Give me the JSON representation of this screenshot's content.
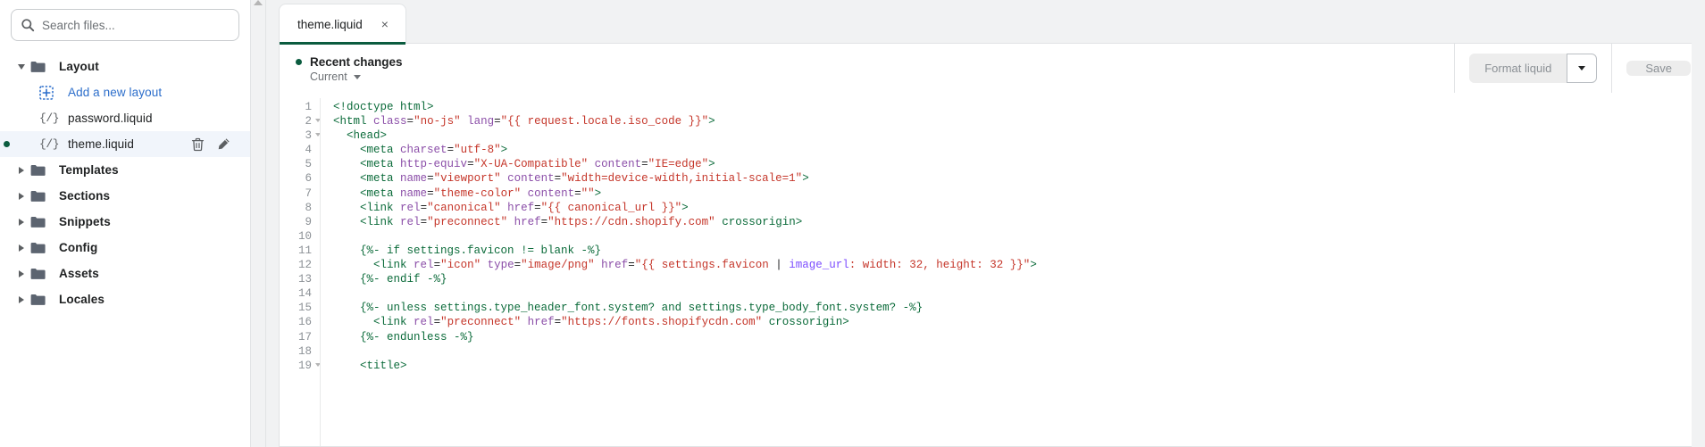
{
  "sidebar": {
    "search": {
      "placeholder": "Search files...",
      "value": "",
      "icon": "search-icon"
    },
    "tree": [
      {
        "label": "Layout",
        "type": "folder",
        "level": 0,
        "expanded": true,
        "icon": "folder-icon"
      },
      {
        "label": "Add a new layout",
        "type": "action",
        "level": 1,
        "icon": "add-box-icon"
      },
      {
        "label": "password.liquid",
        "type": "file",
        "level": 1,
        "icon": "liquid-file-icon"
      },
      {
        "label": "theme.liquid",
        "type": "file",
        "level": 1,
        "icon": "liquid-file-icon",
        "selected": true,
        "modified": true,
        "actions": [
          "delete-icon",
          "rename-icon"
        ]
      },
      {
        "label": "Templates",
        "type": "folder",
        "level": 0,
        "expanded": false,
        "icon": "folder-icon"
      },
      {
        "label": "Sections",
        "type": "folder",
        "level": 0,
        "expanded": false,
        "icon": "folder-icon"
      },
      {
        "label": "Snippets",
        "type": "folder",
        "level": 0,
        "expanded": false,
        "icon": "folder-icon"
      },
      {
        "label": "Config",
        "type": "folder",
        "level": 0,
        "expanded": false,
        "icon": "folder-icon"
      },
      {
        "label": "Assets",
        "type": "folder",
        "level": 0,
        "expanded": false,
        "icon": "folder-icon"
      },
      {
        "label": "Locales",
        "type": "folder",
        "level": 0,
        "expanded": false,
        "icon": "folder-icon"
      }
    ]
  },
  "editor": {
    "tab": {
      "label": "theme.liquid",
      "close_label": "×"
    },
    "recent_changes": {
      "title": "Recent changes",
      "version": "Current",
      "dot_color": "#0b5c3f"
    },
    "actions": {
      "format_label": "Format liquid",
      "format_menu_icon": "chevron-down-icon",
      "save_label": "Save"
    },
    "code": {
      "first_line": 1,
      "lines": [
        {
          "n": 1,
          "fold": false,
          "html": "<span class=\"t-tag\">&lt;!doctype html&gt;</span>"
        },
        {
          "n": 2,
          "fold": true,
          "html": "<span class=\"t-tag\">&lt;html</span> <span class=\"t-attr\">class</span>=<span class=\"t-str\">\"no-js\"</span> <span class=\"t-attr\">lang</span>=<span class=\"t-str\">\"{{ request.locale.iso_code }}\"</span><span class=\"t-tag\">&gt;</span>"
        },
        {
          "n": 3,
          "fold": true,
          "html": "  <span class=\"t-tag\">&lt;head&gt;</span>"
        },
        {
          "n": 4,
          "fold": false,
          "html": "    <span class=\"t-tag\">&lt;meta</span> <span class=\"t-attr\">charset</span>=<span class=\"t-str\">\"utf-8\"</span><span class=\"t-tag\">&gt;</span>"
        },
        {
          "n": 5,
          "fold": false,
          "html": "    <span class=\"t-tag\">&lt;meta</span> <span class=\"t-attr\">http-equiv</span>=<span class=\"t-str\">\"X-UA-Compatible\"</span> <span class=\"t-attr\">content</span>=<span class=\"t-str\">\"IE=edge\"</span><span class=\"t-tag\">&gt;</span>"
        },
        {
          "n": 6,
          "fold": false,
          "html": "    <span class=\"t-tag\">&lt;meta</span> <span class=\"t-attr\">name</span>=<span class=\"t-str\">\"viewport\"</span> <span class=\"t-attr\">content</span>=<span class=\"t-str\">\"width=device-width,initial-scale=1\"</span><span class=\"t-tag\">&gt;</span>"
        },
        {
          "n": 7,
          "fold": false,
          "html": "    <span class=\"t-tag\">&lt;meta</span> <span class=\"t-attr\">name</span>=<span class=\"t-str\">\"theme-color\"</span> <span class=\"t-attr\">content</span>=<span class=\"t-str\">\"\"</span><span class=\"t-tag\">&gt;</span>"
        },
        {
          "n": 8,
          "fold": false,
          "html": "    <span class=\"t-tag\">&lt;link</span> <span class=\"t-attr\">rel</span>=<span class=\"t-str\">\"canonical\"</span> <span class=\"t-attr\">href</span>=<span class=\"t-str\">\"{{ canonical_url }}\"</span><span class=\"t-tag\">&gt;</span>"
        },
        {
          "n": 9,
          "fold": false,
          "html": "    <span class=\"t-tag\">&lt;link</span> <span class=\"t-attr\">rel</span>=<span class=\"t-str\">\"preconnect\"</span> <span class=\"t-attr\">href</span>=<span class=\"t-str\">\"https://cdn.shopify.com\"</span> <span class=\"t-tag\">crossorigin&gt;</span>"
        },
        {
          "n": 10,
          "fold": false,
          "html": ""
        },
        {
          "n": 11,
          "fold": false,
          "html": "    <span class=\"t-liq\">{%- if settings.favicon != blank -%}</span>"
        },
        {
          "n": 12,
          "fold": false,
          "html": "      <span class=\"t-tag\">&lt;link</span> <span class=\"t-attr\">rel</span>=<span class=\"t-str\">\"icon\"</span> <span class=\"t-attr\">type</span>=<span class=\"t-str\">\"image/png\"</span> <span class=\"t-attr\">href</span>=<span class=\"t-str\">\"{{ settings.favicon </span><span class=\"t-punc\">|</span><span class=\"t-filt\"> image_url</span><span class=\"t-str\">: width: 32, height: 32 }}\"</span><span class=\"t-tag\">&gt;</span>"
        },
        {
          "n": 13,
          "fold": false,
          "html": "    <span class=\"t-liq\">{%- endif -%}</span>"
        },
        {
          "n": 14,
          "fold": false,
          "html": ""
        },
        {
          "n": 15,
          "fold": false,
          "html": "    <span class=\"t-liq\">{%- unless settings.type_header_font.system? and settings.type_body_font.system? -%}</span>"
        },
        {
          "n": 16,
          "fold": false,
          "html": "      <span class=\"t-tag\">&lt;link</span> <span class=\"t-attr\">rel</span>=<span class=\"t-str\">\"preconnect\"</span> <span class=\"t-attr\">href</span>=<span class=\"t-str\">\"https://fonts.shopifycdn.com\"</span> <span class=\"t-tag\">crossorigin&gt;</span>"
        },
        {
          "n": 17,
          "fold": false,
          "html": "    <span class=\"t-liq\">{%- endunless -%}</span>"
        },
        {
          "n": 18,
          "fold": false,
          "html": ""
        },
        {
          "n": 19,
          "fold": true,
          "html": "    <span class=\"t-tag\">&lt;title&gt;</span>"
        }
      ]
    }
  },
  "colors": {
    "accent_green": "#0b5c3f",
    "link_blue": "#2c6ecb",
    "panel_bg": "#f1f2f3",
    "border": "#e1e3e5"
  }
}
